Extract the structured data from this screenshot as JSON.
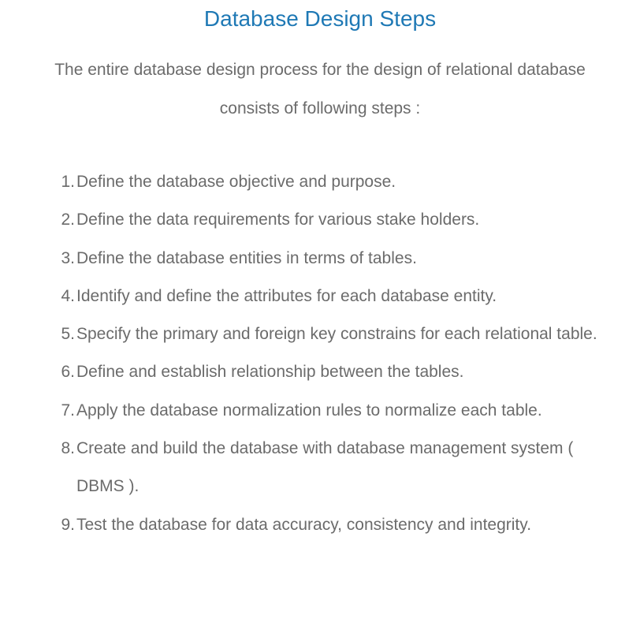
{
  "title": "Database Design Steps",
  "intro": "The entire database design process for the design of relational database consists of following steps :",
  "steps": [
    {
      "num": "1.",
      "text": "Define the database objective and purpose."
    },
    {
      "num": "2.",
      "text": "Define the data requirements for various stake holders."
    },
    {
      "num": "3.",
      "text": "Define the database entities in terms of tables."
    },
    {
      "num": "4.",
      "text": "Identify and define the attributes for each database entity."
    },
    {
      "num": "5.",
      "text": "Specify the primary and foreign key constrains for each relational table."
    },
    {
      "num": "6.",
      "text": "Define and establish relationship between the tables."
    },
    {
      "num": "7.",
      "text": "Apply the database normalization rules to normalize each table."
    },
    {
      "num": "8.",
      "text": "Create and build the database with database management system ( DBMS )."
    },
    {
      "num": "9.",
      "text": "Test the database for data accuracy, consistency and integrity."
    }
  ],
  "colors": {
    "title": "#1f79b5",
    "text": "#6b6b6b",
    "background": "#ffffff"
  }
}
